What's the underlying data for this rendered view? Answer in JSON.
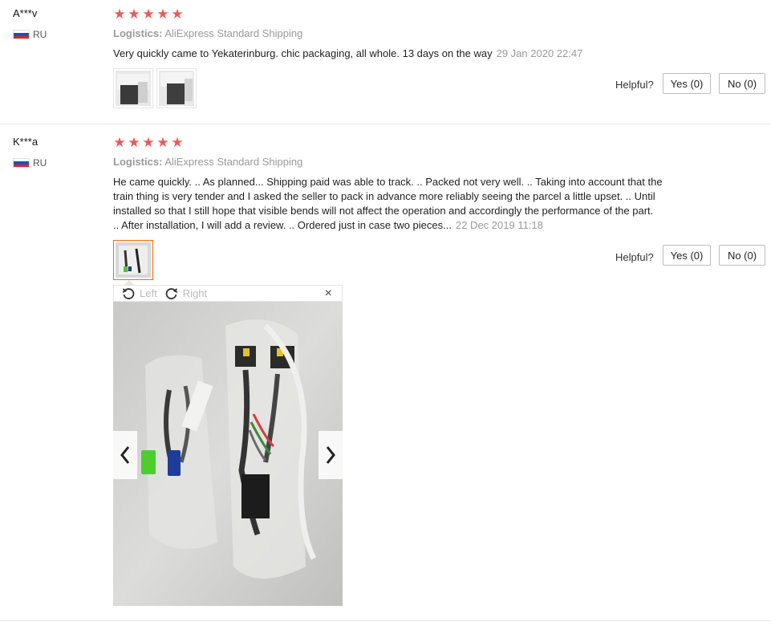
{
  "reviews": [
    {
      "user": "A***v",
      "country": "RU",
      "rating": 5,
      "logistics_label": "Logistics:",
      "logistics_value": "AliExpress Standard Shipping",
      "text": "Very quickly came to Yekaterinburg. chic packaging, all whole. 13 days on the way",
      "date": "29 Jan 2020 22:47",
      "helpful_label": "Helpful?",
      "yes_label": "Yes (0)",
      "no_label": "No (0)"
    },
    {
      "user": "K***a",
      "country": "RU",
      "rating": 5,
      "logistics_label": "Logistics:",
      "logistics_value": "AliExpress Standard Shipping",
      "text_lines": [
        "He came quickly. .. As planned... Shipping paid was able to track. .. Packed not very well. .. Taking into account that the",
        "train thing is very tender and I asked the seller to pack in advance more reliably seeing the parcel a little upset. .. Until",
        "installed so that I still hope that visible bends will not affect the operation and accordingly the performance of the part.",
        ".. After installation, I will add a review. .. Ordered just in case two pieces..."
      ],
      "date": "22 Dec 2019 11:18",
      "helpful_label": "Helpful?",
      "yes_label": "Yes (0)",
      "no_label": "No (0)"
    }
  ],
  "viewer": {
    "rotate_left_label": "Left",
    "rotate_right_label": "Right",
    "close_glyph": "×"
  },
  "icons": {
    "star": "star-icon",
    "flag": "russia-flag-icon",
    "rotate_left": "rotate-left-icon",
    "rotate_right": "rotate-right-icon",
    "close": "close-icon",
    "prev": "chevron-left-icon",
    "next": "chevron-right-icon"
  },
  "colors": {
    "star": "#e85b57",
    "active_thumb_border": "#ff6600",
    "muted_text": "#999999"
  }
}
